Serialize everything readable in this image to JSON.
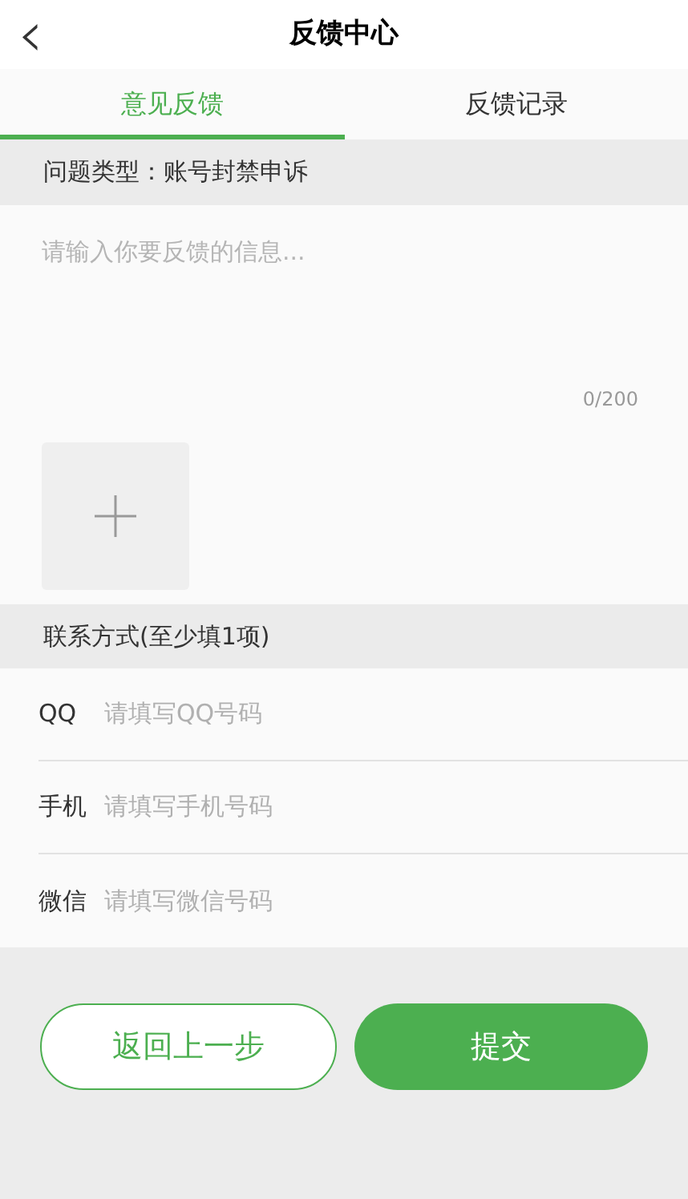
{
  "header": {
    "back": "‹",
    "title": "反馈中心"
  },
  "tabs": [
    {
      "label": "意见反馈",
      "selected": true
    },
    {
      "label": "反馈记录",
      "selected": false
    }
  ],
  "problem_type": "问题类型：账号封禁申诉",
  "feedback": {
    "placeholder": "请输入你要反馈的信息...",
    "counter": "0/200"
  },
  "contact": {
    "heading": "联系方式(至少填1项)",
    "fields": [
      {
        "label": "QQ",
        "placeholder": "请填写QQ号码"
      },
      {
        "label": "手机",
        "placeholder": "请填写手机号码"
      },
      {
        "label": "微信",
        "placeholder": "请填写微信号码"
      }
    ]
  },
  "buttons": [
    {
      "label": "返回上一步",
      "kind": "secondary"
    },
    {
      "label": "提交",
      "kind": "primary"
    }
  ]
}
